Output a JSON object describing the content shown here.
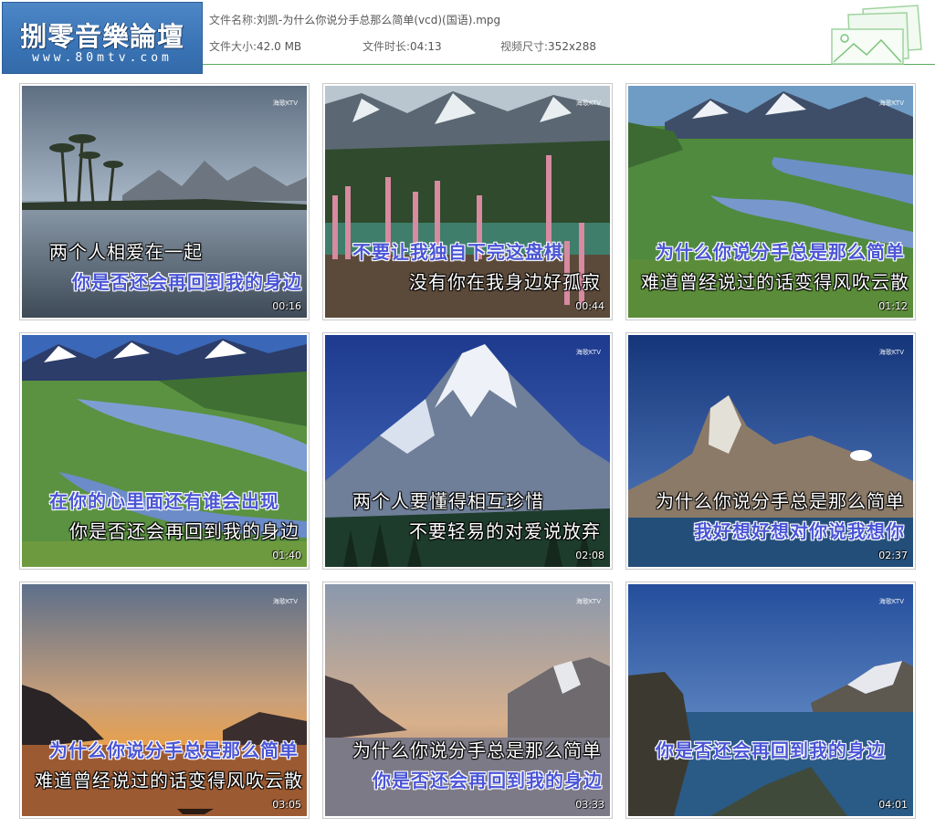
{
  "header": {
    "logo_title": "捌零音樂論壇",
    "logo_url": "www.80mtv.com",
    "file_name_label": "文件名称:",
    "file_name": "刘凯-为什么你说分手总那么简单(vcd)(国语).mpg",
    "file_size_label": "文件大小:",
    "file_size": "42.0 MB",
    "duration_label": "文件时长:",
    "duration": "04:13",
    "dimensions_label": "视频尺寸:",
    "dimensions": "352x288"
  },
  "watermark": "海歌KTV",
  "thumbnails": [
    {
      "time": "00:16",
      "line1": "两个人相爱在一起",
      "line2": "你是否还会再回到我的身边"
    },
    {
      "time": "00:44",
      "line1": "不要让我独自下完这盘棋",
      "line2": "没有你在我身边好孤寂"
    },
    {
      "time": "01:12",
      "line1": "为什么你说分手总是那么简单",
      "line2": "难道曾经说过的话变得风吹云散"
    },
    {
      "time": "01:40",
      "line1": "在你的心里面还有谁会出现",
      "line2": "你是否还会再回到我的身边"
    },
    {
      "time": "02:08",
      "line1": "两个人要懂得相互珍惜",
      "line2": "不要轻易的对爱说放弃"
    },
    {
      "time": "02:37",
      "line1": "为什么你说分手总是那么简单",
      "line2": "我好想好想对你说我想你"
    },
    {
      "time": "03:05",
      "line1": "为什么你说分手总是那么简单",
      "line2": "难道曾经说过的话变得风吹云散"
    },
    {
      "time": "03:33",
      "line1": "为什么你说分手总是那么简单",
      "line2": "你是否还会再回到我的身边"
    },
    {
      "time": "04:01",
      "line1": "你是否还会再回到我的身边",
      "line2": ""
    }
  ]
}
